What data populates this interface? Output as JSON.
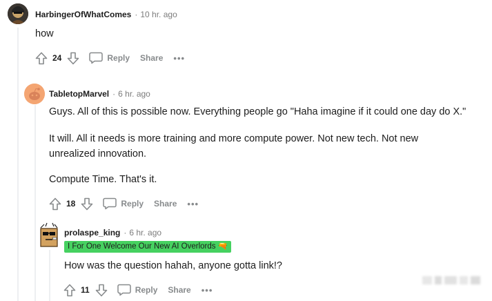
{
  "comments": [
    {
      "author": "HarbingerOfWhatComes",
      "time": "10 hr. ago",
      "body": [
        "how"
      ],
      "score": "24",
      "reply_label": "Reply",
      "share_label": "Share",
      "more_label": "•••"
    },
    {
      "author": "TabletopMarvel",
      "time": "6 hr. ago",
      "body": [
        "Guys. All of this is possible now. Everything people go \"Haha imagine if it could one day do X.\"",
        "It will. All it needs is more training and more compute power. Not new tech. Not new",
        "unrealized innovation.",
        "Compute Time. That's it."
      ],
      "score": "18",
      "reply_label": "Reply",
      "share_label": "Share",
      "more_label": "•••"
    },
    {
      "author": "prolaspe_king",
      "time": "6 hr. ago",
      "flair": "I For One Welcome Our New AI Overlords 🔫",
      "body": [
        "How was the question hahah, anyone gotta link!?"
      ],
      "score": "11",
      "reply_label": "Reply",
      "share_label": "Share",
      "more_label": "•••"
    }
  ],
  "separator": "·",
  "colors": {
    "flair_bg": "#46d160",
    "meta_gray": "#7c7c7c",
    "action_gray": "#878a8c",
    "thread_line": "#edeff1",
    "snoo_orange": "#f4a572"
  },
  "icons": [
    "upvote-icon",
    "downvote-icon",
    "comment-bubble-icon"
  ]
}
